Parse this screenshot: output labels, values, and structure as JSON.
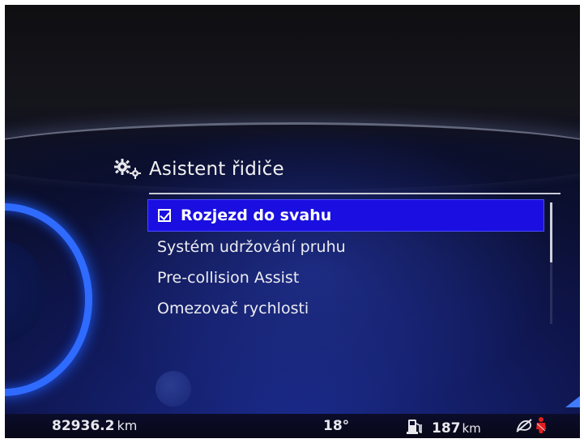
{
  "menu": {
    "title": "Asistent řidiče",
    "title_icon": "gears-icon",
    "items": [
      {
        "label": "Rozjezd do svahu",
        "selected": true,
        "checked": true
      },
      {
        "label": "Systém udržování pruhu",
        "selected": false
      },
      {
        "label": "Pre-collision Assist",
        "selected": false
      },
      {
        "label": "Omezovač rychlosti",
        "selected": false
      }
    ]
  },
  "status": {
    "odometer_value": "82936.2",
    "odometer_unit": "km",
    "temperature": "18°",
    "range_value": "187",
    "range_unit": "km",
    "fuel_icon": "fuel-pump-icon",
    "warning_icons": [
      "driver-assist-off-icon",
      "seatbelt-warning-icon"
    ]
  },
  "colors": {
    "selection": "#1a0fe0",
    "gauge_ring": "#2f6bff",
    "warning_red": "#e02020"
  }
}
